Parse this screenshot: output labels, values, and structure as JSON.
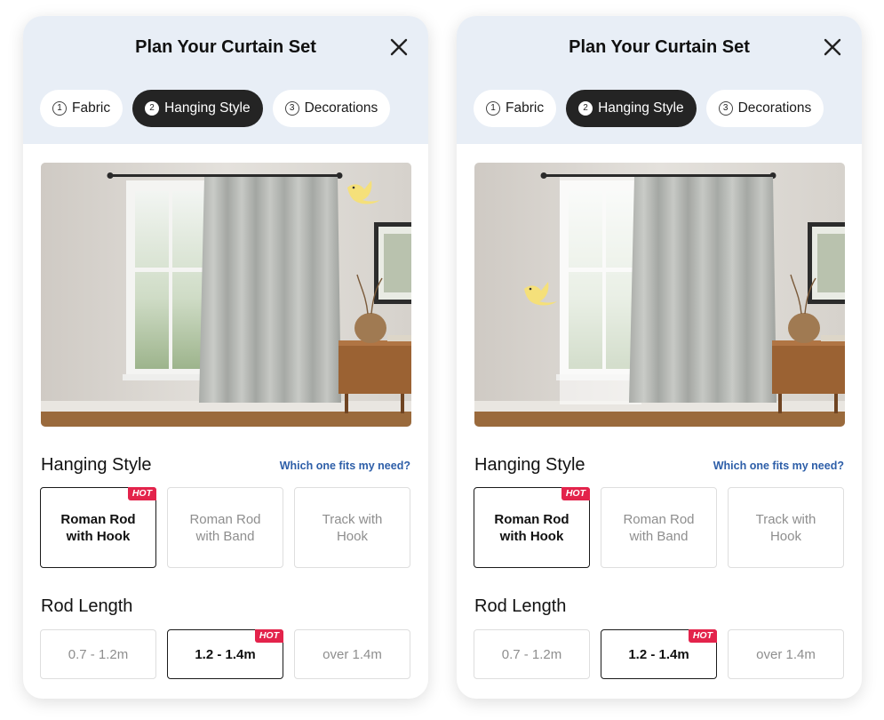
{
  "panels": [
    {
      "title": "Plan Your Curtain Set",
      "steps": [
        {
          "num": "1",
          "label": "Fabric"
        },
        {
          "num": "2",
          "label": "Hanging Style"
        },
        {
          "num": "3",
          "label": "Decorations"
        }
      ],
      "active_step": 2,
      "preview": {
        "sheer_layer": false
      },
      "hanging_style": {
        "title": "Hanging Style",
        "help_link": "Which one fits my need?",
        "options": [
          "Roman Rod\nwith Hook",
          "Roman Rod\nwith Band",
          "Track with\nHook"
        ],
        "selected": 0,
        "hot_badge": "HOT"
      },
      "rod_length": {
        "title": "Rod Length",
        "options": [
          "0.7 - 1.2m",
          "1.2 - 1.4m",
          "over 1.4m"
        ],
        "selected": 1,
        "hot_badge": "HOT"
      }
    },
    {
      "title": "Plan Your Curtain Set",
      "steps": [
        {
          "num": "1",
          "label": "Fabric"
        },
        {
          "num": "2",
          "label": "Hanging Style"
        },
        {
          "num": "3",
          "label": "Decorations"
        }
      ],
      "active_step": 2,
      "preview": {
        "sheer_layer": true
      },
      "hanging_style": {
        "title": "Hanging Style",
        "help_link": "Which one fits my need?",
        "options": [
          "Roman Rod\nwith Hook",
          "Roman Rod\nwith Band",
          "Track with\nHook"
        ],
        "selected": 0,
        "hot_badge": "HOT"
      },
      "rod_length": {
        "title": "Rod Length",
        "options": [
          "0.7 - 1.2m",
          "1.2 - 1.4m",
          "over 1.4m"
        ],
        "selected": 1,
        "hot_badge": "HOT"
      }
    }
  ],
  "icons": {
    "close": "close-icon",
    "bird": "bird-icon"
  },
  "colors": {
    "header_bg": "#e8eef6",
    "active_step_bg": "#242424",
    "hot_badge": "#e3234b",
    "link": "#2d5ea8",
    "selected_border": "#1a1a1a"
  }
}
